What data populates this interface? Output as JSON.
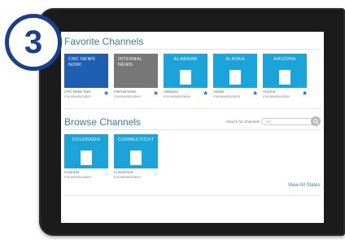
{
  "step_number": "3",
  "favorite_section": {
    "title": "Favorite Channels",
    "tiles": [
      {
        "label": "CNC NEWS NOW!",
        "name": "CNC News Now",
        "owner": "mouseeducation",
        "color": "#1f5fb2",
        "starred": true,
        "shape": false
      },
      {
        "label": "INTERNAL NEWS",
        "name": "Internal News",
        "owner": "mouseeducation",
        "color": "#777777",
        "starred": true,
        "shape": false
      },
      {
        "label": "ALABAMA",
        "name": "Alabama",
        "owner": "mouseeducation",
        "color": "#1aa4d9",
        "starred": true,
        "shape": true
      },
      {
        "label": "ALASKA",
        "name": "Alaska",
        "owner": "mouseeducation",
        "color": "#1aa4d9",
        "starred": true,
        "shape": true
      },
      {
        "label": "ARIZONA",
        "name": "Arizona",
        "owner": "mouseeducation",
        "color": "#1aa4d9",
        "starred": true,
        "shape": true
      }
    ]
  },
  "browse_section": {
    "title": "Browse Channels",
    "search_label": "Search for Channels",
    "search_placeholder": "Go",
    "tiles": [
      {
        "label": "COLORADO",
        "name": "Colorado",
        "owner": "mouseeducation",
        "color": "#1aa4d9",
        "starred": false,
        "shape": true
      },
      {
        "label": "CONNECTICUT",
        "name": "Connecticut",
        "owner": "mouseeducation",
        "color": "#1aa4d9",
        "starred": false,
        "shape": true
      }
    ],
    "view_all": "View All States"
  },
  "icons": {
    "star": "star-icon",
    "search": "search-icon",
    "step_badge": "step-badge"
  }
}
